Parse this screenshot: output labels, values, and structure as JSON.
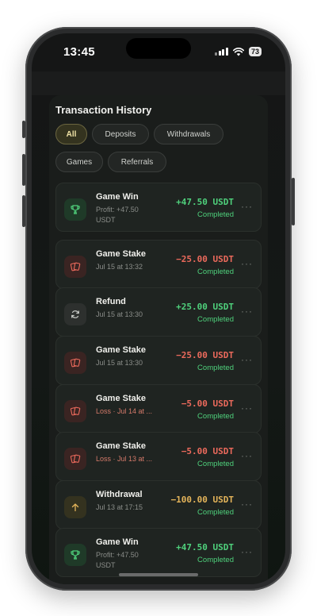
{
  "status_bar": {
    "time": "13:45",
    "battery": "73",
    "signal_icon": "signal-icon",
    "wifi_icon": "wifi-icon"
  },
  "section_title": "Transaction History",
  "filters": [
    {
      "label": "All",
      "active": true
    },
    {
      "label": "Deposits",
      "active": false
    },
    {
      "label": "Withdrawals",
      "active": false
    },
    {
      "label": "Games",
      "active": false
    },
    {
      "label": "Referrals",
      "active": false
    }
  ],
  "transactions": [
    {
      "title": "Game Win",
      "subtitle": "Profit: +47.50 USDT",
      "amount": "+47.50 USDT",
      "status": "Completed",
      "icon": "trophy-icon",
      "kind": "win"
    },
    {
      "title": "Game Stake",
      "subtitle": "Jul 15 at 13:32",
      "amount": "−25.00 USDT",
      "status": "Completed",
      "icon": "cards-icon",
      "kind": "stake"
    },
    {
      "title": "Refund",
      "subtitle": "Jul 15 at 13:30",
      "amount": "+25.00 USDT",
      "status": "Completed",
      "icon": "refresh-icon",
      "kind": "refund"
    },
    {
      "title": "Game Stake",
      "subtitle": "Jul 15 at 13:30",
      "amount": "−25.00 USDT",
      "status": "Completed",
      "icon": "cards-icon",
      "kind": "stake"
    },
    {
      "title": "Game Stake",
      "subtitle": "Loss · Jul 14 at ...",
      "amount": "−5.00 USDT",
      "status": "Completed",
      "icon": "cards-icon",
      "kind": "stake-loss"
    },
    {
      "title": "Game Stake",
      "subtitle": "Loss · Jul 13 at ...",
      "amount": "−5.00 USDT",
      "status": "Completed",
      "icon": "cards-icon",
      "kind": "stake-loss"
    },
    {
      "title": "Withdrawal",
      "subtitle": "Jul 13 at 17:15",
      "amount": "−100.00 USDT",
      "status": "Completed",
      "icon": "arrow-up-icon",
      "kind": "withdrawal"
    },
    {
      "title": "Game Win",
      "subtitle": "Profit: +47.50 USDT",
      "amount": "+47.50 USDT",
      "status": "Completed",
      "icon": "trophy-icon",
      "kind": "win"
    }
  ],
  "more_label": "···",
  "colors": {
    "positive": "#4fd17c",
    "negative": "#ec6a5c",
    "withdrawal": "#e4b45a",
    "chip_active": "#f0e3a6"
  }
}
